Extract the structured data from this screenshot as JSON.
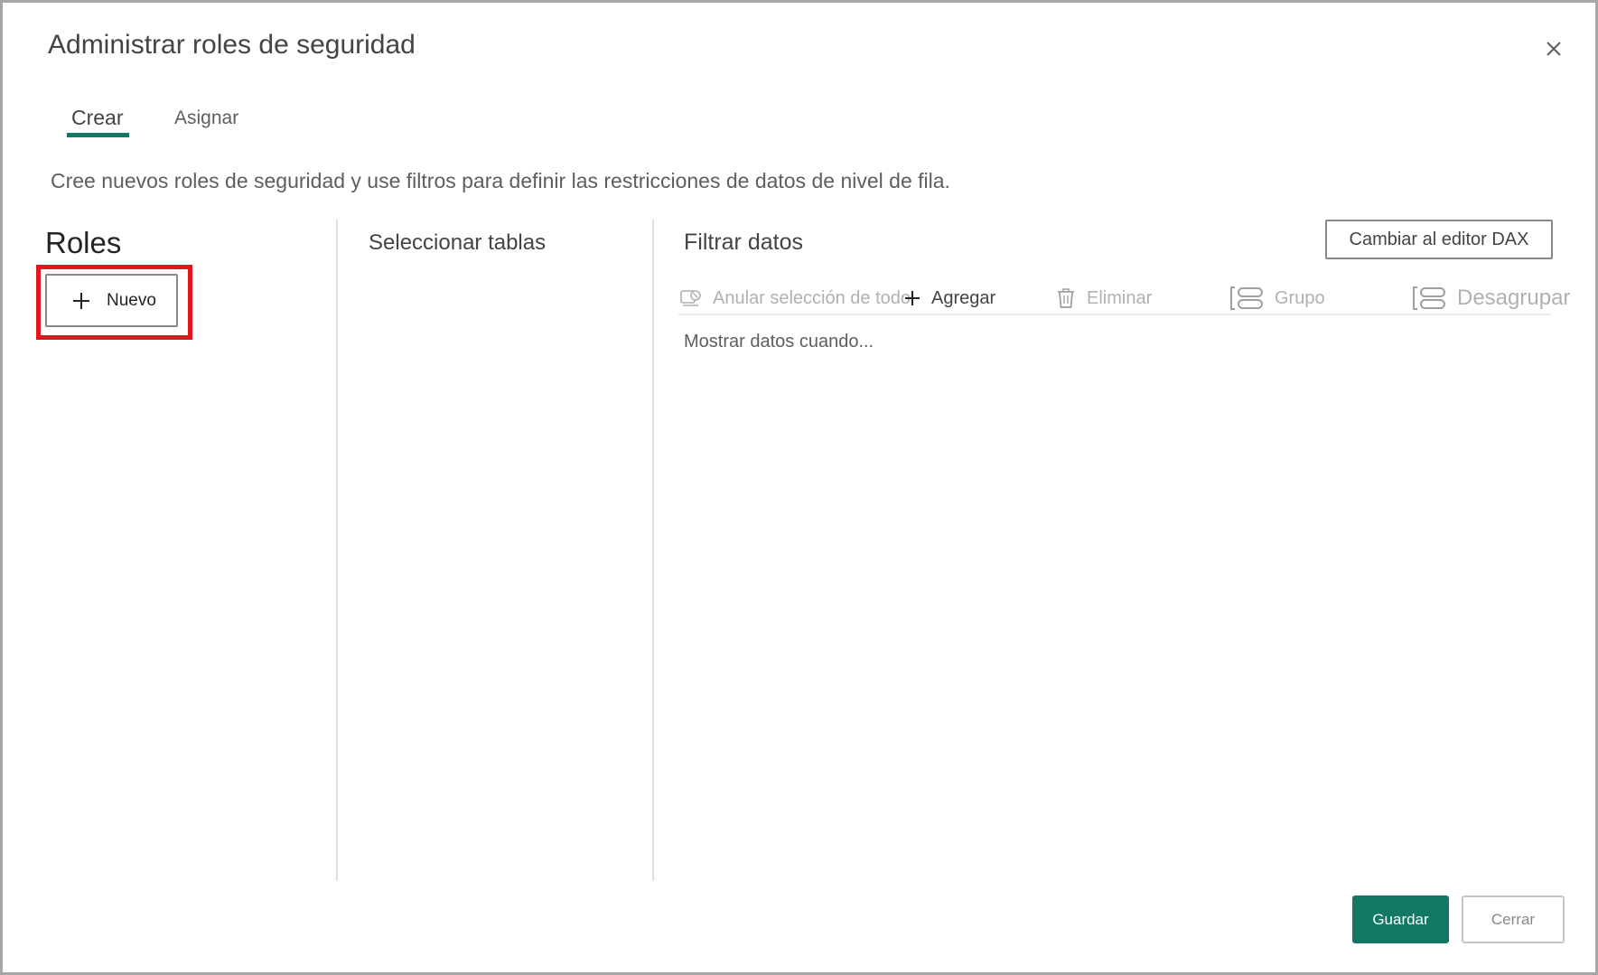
{
  "dialog": {
    "title": "Administrar roles de seguridad",
    "close_icon": "close-icon"
  },
  "tabs": [
    {
      "label": "Crear",
      "active": true
    },
    {
      "label": "Asignar",
      "active": false
    }
  ],
  "description": "Cree nuevos roles de seguridad y use filtros para definir las restricciones de datos de nivel de fila.",
  "roles": {
    "heading": "Roles",
    "new_label": "Nuevo",
    "new_icon": "plus-icon"
  },
  "tables": {
    "heading": "Seleccionar tablas"
  },
  "filter": {
    "heading": "Filtrar datos",
    "dax_button_label": "Cambiar al editor DAX",
    "toolbar": {
      "clear_all": "Anular selección de todo",
      "add": "Agregar",
      "delete": "Eliminar",
      "group": "Grupo",
      "ungroup": "Desagrupar"
    },
    "show_data_when": "Mostrar datos cuando..."
  },
  "footer": {
    "save_label": "Guardar",
    "cancel_label": "Cerrar"
  },
  "colors": {
    "accent": "#117865",
    "highlight": "#e3161e"
  }
}
